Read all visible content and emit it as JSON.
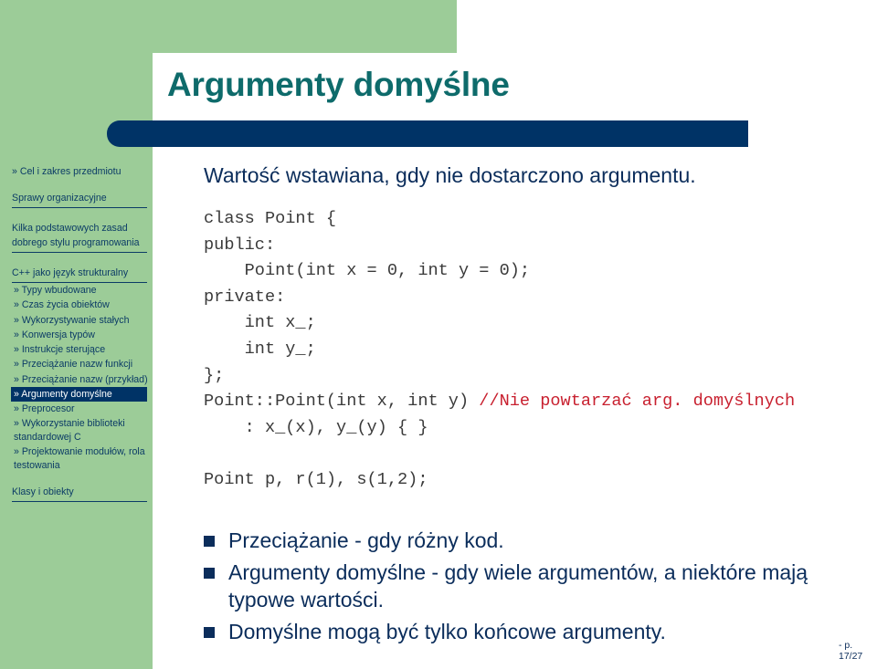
{
  "title": "Argumenty domyślne",
  "colors": {
    "green": "#9ccc98",
    "navy": "#003366",
    "title": "#0e6b6b",
    "text": "#0b2d5b",
    "comment": "#c8202f"
  },
  "sidebar": {
    "sections": [
      {
        "label": "» Cel i zakres przedmiotu",
        "underlined": false
      },
      {
        "label": "Sprawy organizacyjne",
        "underlined": true
      },
      {
        "label": "Kilka podstawowych zasad dobrego stylu programowania",
        "underlined": true
      },
      {
        "label": "C++ jako język strukturalny",
        "underlined": true
      }
    ],
    "subitems": [
      {
        "label": "» Typy wbudowane"
      },
      {
        "label": "» Czas życia obiektów"
      },
      {
        "label": "» Wykorzystywanie stałych"
      },
      {
        "label": "» Konwersja typów"
      },
      {
        "label": "» Instrukcje sterujące"
      },
      {
        "label": "» Przeciążanie nazw funkcji"
      },
      {
        "label": "» Przeciążanie nazw (przykład)"
      },
      {
        "label": "» Argumenty domyślne",
        "active": true
      },
      {
        "label": "» Preprocesor"
      },
      {
        "label": "» Wykorzystanie biblioteki standardowej C"
      },
      {
        "label": "» Projektowanie modułów, rola testowania"
      }
    ],
    "last_section": {
      "label": "Klasy i obiekty"
    }
  },
  "content": {
    "intro": "Wartość wstawiana, gdy nie dostarczono argumentu.",
    "code_lines": [
      "class Point {",
      "public:",
      "    Point(int x = 0, int y = 0);",
      "private:",
      "    int x_;",
      "    int y_;",
      "};"
    ],
    "code_impl": "Point::Point(int x, int y) ",
    "code_comment": "//Nie powtarzać arg. domyślnych",
    "code_init": "    : x_(x), y_(y) { }",
    "code_usage": "Point p, r(1), s(1,2);",
    "bullets": [
      "Przeciążanie - gdy różny kod.",
      "Argumenty domyślne - gdy wiele argumentów, a niektóre mają typowe wartości.",
      "Domyślne mogą być tylko końcowe argumenty."
    ]
  },
  "footer": {
    "page": "- p. 17/27"
  }
}
